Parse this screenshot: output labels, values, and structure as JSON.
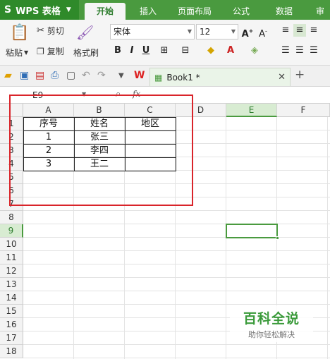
{
  "app": {
    "name": "WPS 表格",
    "icon": "wps-s-icon"
  },
  "ribbon_tabs": [
    {
      "label": "开始",
      "active": true
    },
    {
      "label": "插入"
    },
    {
      "label": "页面布局"
    },
    {
      "label": "公式"
    },
    {
      "label": "数据"
    },
    {
      "label": "审"
    }
  ],
  "clipboard": {
    "paste": "粘贴",
    "cut": "剪切",
    "copy": "复制",
    "format_painter": "格式刷"
  },
  "font": {
    "name": "宋体",
    "size": "12"
  },
  "format_buttons": {
    "bold": "B",
    "italic": "I",
    "underline": "U"
  },
  "document_tab": {
    "title": "Book1 *"
  },
  "formula_bar": {
    "cell_ref": "E9",
    "fx": "fx"
  },
  "columns": [
    "A",
    "B",
    "C",
    "D",
    "E",
    "F"
  ],
  "rows": [
    "1",
    "2",
    "3",
    "4",
    "5",
    "6",
    "7",
    "8",
    "9",
    "10",
    "11",
    "12",
    "13",
    "14",
    "15",
    "16",
    "17",
    "18"
  ],
  "selected_cell": {
    "column": "E",
    "row": "9"
  },
  "table": {
    "headers": [
      "序号",
      "姓名",
      "地区"
    ],
    "rows": [
      [
        "1",
        "张三",
        ""
      ],
      [
        "2",
        "李四",
        ""
      ],
      [
        "3",
        "王二",
        ""
      ]
    ]
  },
  "watermark": {
    "title": "百科全说",
    "subtitle": "助你轻松解决"
  },
  "colors": {
    "accent": "#4a9a3f",
    "highlight_box": "#d9242a"
  }
}
